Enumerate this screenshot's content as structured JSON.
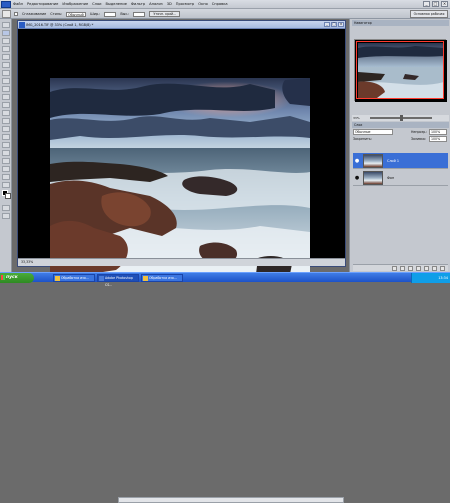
{
  "menubar": {
    "items": [
      "Файл",
      "Редактирование",
      "Изображение",
      "Слои",
      "Выделение",
      "Фильтр",
      "Анализ",
      "3D",
      "Просмотр",
      "Окно",
      "Справка"
    ],
    "window_buttons": [
      "_",
      "□",
      "×"
    ]
  },
  "options_bar": {
    "checkbox_label": "Сглаживание",
    "style_label": "Стиль:",
    "style_value": "Обычный",
    "width_label": "Шир.:",
    "height_label": "Выс.:",
    "refine_button": "Уточн. край...",
    "workspace_button": "Основная рабочая среда"
  },
  "document": {
    "title": "IMG_2016.TIF @ 33% (Слой 1, RGB/8) *",
    "status": "33,33%",
    "controls": [
      "_",
      "□",
      "×"
    ]
  },
  "panels": {
    "navigator_title": "Навигатор",
    "zoom_value": "33%",
    "layers_title": "Слои",
    "blend_mode": "Обычные",
    "opacity_label": "Непрозр.:",
    "opacity_value": "100%",
    "lock_label": "Закрепить:",
    "fill_label": "Заливка:",
    "fill_value": "100%",
    "layers": [
      {
        "name": "Слой 1",
        "selected": true
      },
      {
        "name": "Фон",
        "selected": false
      }
    ]
  },
  "taskbar": {
    "start_label": "пуск",
    "tasks": [
      "Обработка изо...",
      "Adobe Photoshop CS...",
      "Обработка изо..."
    ],
    "clock": "13:34"
  },
  "colors": {
    "selection": "#3a6fd6",
    "taskbar": "#1d52c7",
    "start": "#2e8a22",
    "nav_frame": "#ff3b2f"
  }
}
